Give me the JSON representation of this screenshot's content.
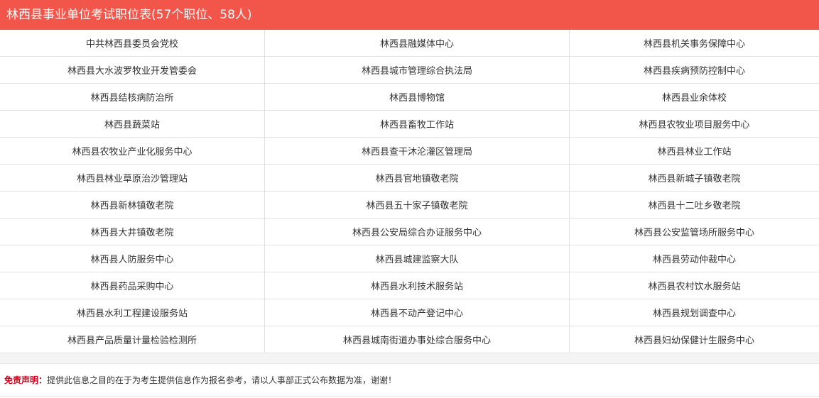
{
  "header": {
    "title": "林西县事业单位考试职位表(57个职位、58人)"
  },
  "rows": [
    [
      "中共林西县委员会党校",
      "林西县融媒体中心",
      "林西县机关事务保障中心"
    ],
    [
      "林西县大水波罗牧业开发管委会",
      "林西县城市管理综合执法局",
      "林西县疾病预防控制中心"
    ],
    [
      "林西县结核病防治所",
      "林西县博物馆",
      "林西县业余体校"
    ],
    [
      "林西县蔬菜站",
      "林西县畜牧工作站",
      "林西县农牧业项目服务中心"
    ],
    [
      "林西县农牧业产业化服务中心",
      "林西县查干沐沦灌区管理局",
      "林西县林业工作站"
    ],
    [
      "林西县林业草原治沙管理站",
      "林西县官地镇敬老院",
      "林西县新城子镇敬老院"
    ],
    [
      "林西县新林镇敬老院",
      "林西县五十家子镇敬老院",
      "林西县十二吐乡敬老院"
    ],
    [
      "林西县大井镇敬老院",
      "林西县公安局综合办证服务中心",
      "林西县公安监管场所服务中心"
    ],
    [
      "林西县人防服务中心",
      "林西县城建监察大队",
      "林西县劳动仲裁中心"
    ],
    [
      "林西县药品采购中心",
      "林西县水利技术服务站",
      "林西县农村饮水服务站"
    ],
    [
      "林西县水利工程建设服务站",
      "林西县不动产登记中心",
      "林西县规划调查中心"
    ],
    [
      "林西县产品质量计量检验检测所",
      "林西县城南街道办事处综合服务中心",
      "林西县妇幼保健计生服务中心"
    ]
  ],
  "disclaimer": {
    "label": "免责声明：",
    "text": "提供此信息之目的在于为考生提供信息作为报名参考，请以人事部正式公布数据为准，谢谢！"
  },
  "colors": {
    "header_bg": "#f25549",
    "disclaimer_label": "#d0021b"
  }
}
